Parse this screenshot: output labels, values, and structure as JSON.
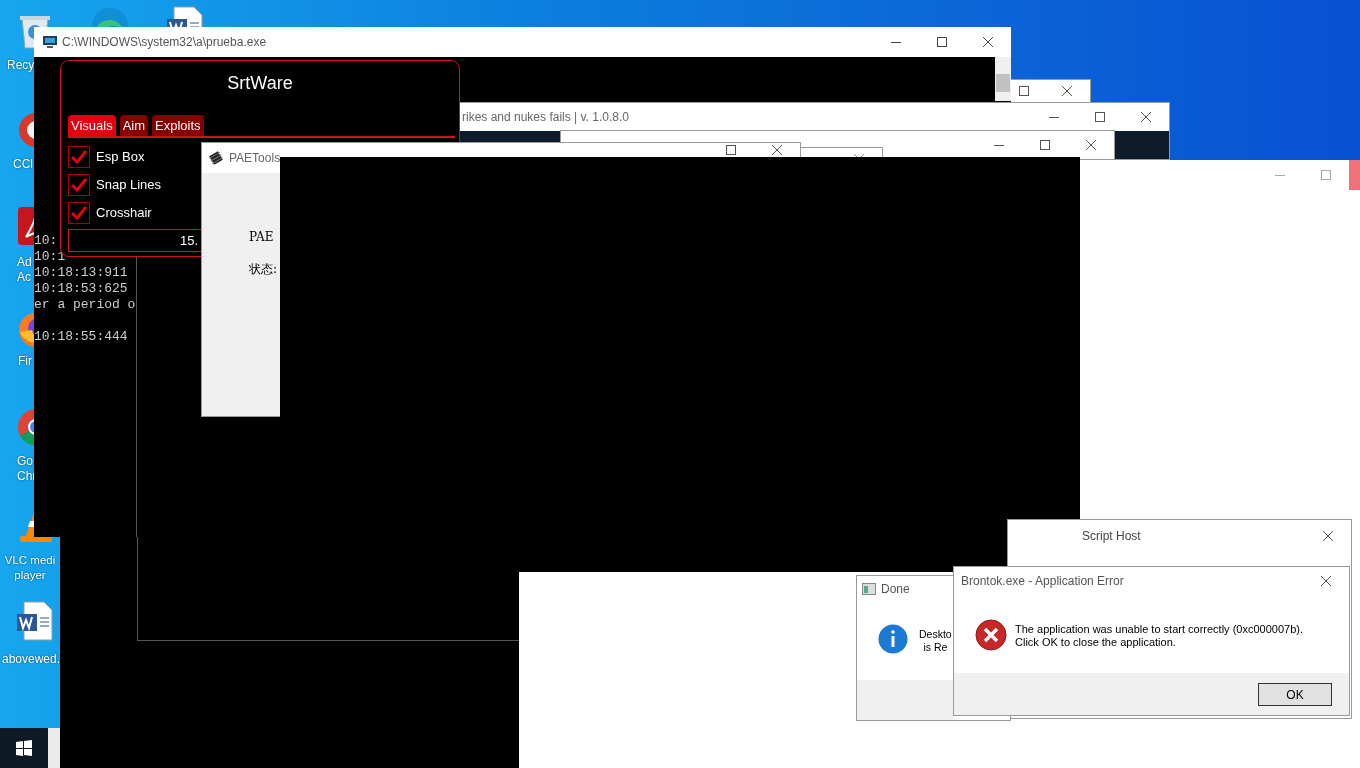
{
  "desktop_icons": [
    {
      "kind": "recycle",
      "label": "Recy"
    },
    {
      "kind": "ccleaner",
      "label": "CCl"
    },
    {
      "kind": "acrobat",
      "label": "Ad\nAc"
    },
    {
      "kind": "firefox",
      "label": "Fir"
    },
    {
      "kind": "chrome",
      "label": "Go\nChr"
    },
    {
      "kind": "vlc",
      "label": "VLC medi\nplayer"
    },
    {
      "kind": "word",
      "label": "abovewed."
    },
    {
      "kind": "edge"
    },
    {
      "kind": "word"
    }
  ],
  "console_window": {
    "title": "C:\\WINDOWS\\system32\\a\\prueba.exe",
    "lines": [
      "10:",
      "10:1",
      "10:18:13:911",
      "10:18:53:625",
      "er a period o"
    ],
    "tail_lines": [
      "10:18:55:444"
    ]
  },
  "game_window": {
    "title": "rikes and nukes fails | v. 1.0.8.0"
  },
  "srtware": {
    "title": "SrtWare",
    "tabs": [
      {
        "label": "Visuals",
        "selected": true
      },
      {
        "label": "Aim",
        "selected": false
      },
      {
        "label": "Exploits",
        "selected": false
      }
    ],
    "options": [
      {
        "label": "Esp Box",
        "checked": true
      },
      {
        "label": "Snap Lines",
        "checked": true
      },
      {
        "label": "Crosshair",
        "checked": true
      }
    ],
    "value": "15."
  },
  "paetools": {
    "title": "PAETools",
    "labels": [
      "PAE",
      "状态:"
    ]
  },
  "script_host": {
    "title": "Script Host"
  },
  "done_dialog": {
    "title": "Done",
    "message": "Deskto\nis Re"
  },
  "error_dialog": {
    "title": "Brontok.exe - Application Error",
    "message": "The application was unable to start correctly (0xc000007b).\nClick OK to close the application.",
    "button": "OK"
  }
}
